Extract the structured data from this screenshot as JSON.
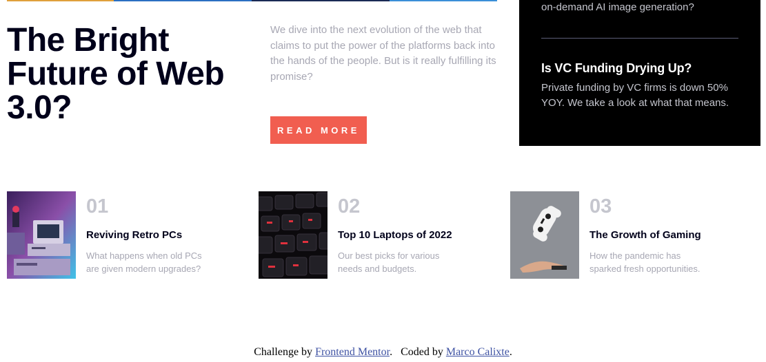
{
  "hero": {
    "title": "The Bright Future of Web 3.0?",
    "lede": "We dive into the next evolution of the web that claims to put the power of the platforms back into the hands of the people. But is it really fulfilling its promise?",
    "cta_label": "READ MORE"
  },
  "sidebar": {
    "previous_item_tail": "on-demand AI image generation?",
    "item": {
      "title": "Is VC Funding Drying Up?",
      "description": "Private funding by VC firms is down 50% YOY. We take a look at what that means."
    }
  },
  "cards": [
    {
      "number": "01",
      "title": "Reviving Retro PCs",
      "description": "What happens when old PCs are given modern upgrades?"
    },
    {
      "number": "02",
      "title": "Top 10 Laptops of 2022",
      "description": "Our best picks for various needs and budgets."
    },
    {
      "number": "03",
      "title": "The Growth of Gaming",
      "description": "How the pandemic has sparked fresh opportunities."
    }
  ],
  "footer": {
    "challenge_prefix": "Challenge by",
    "challenge_link": "Frontend Mentor",
    "coded_prefix": "Coded by",
    "coded_link": "Marco Calixte"
  },
  "colors": {
    "accent": "#f15e50",
    "dark": "#00001a",
    "muted": "#a7a7b3",
    "sidebar_bg": "#000000"
  }
}
